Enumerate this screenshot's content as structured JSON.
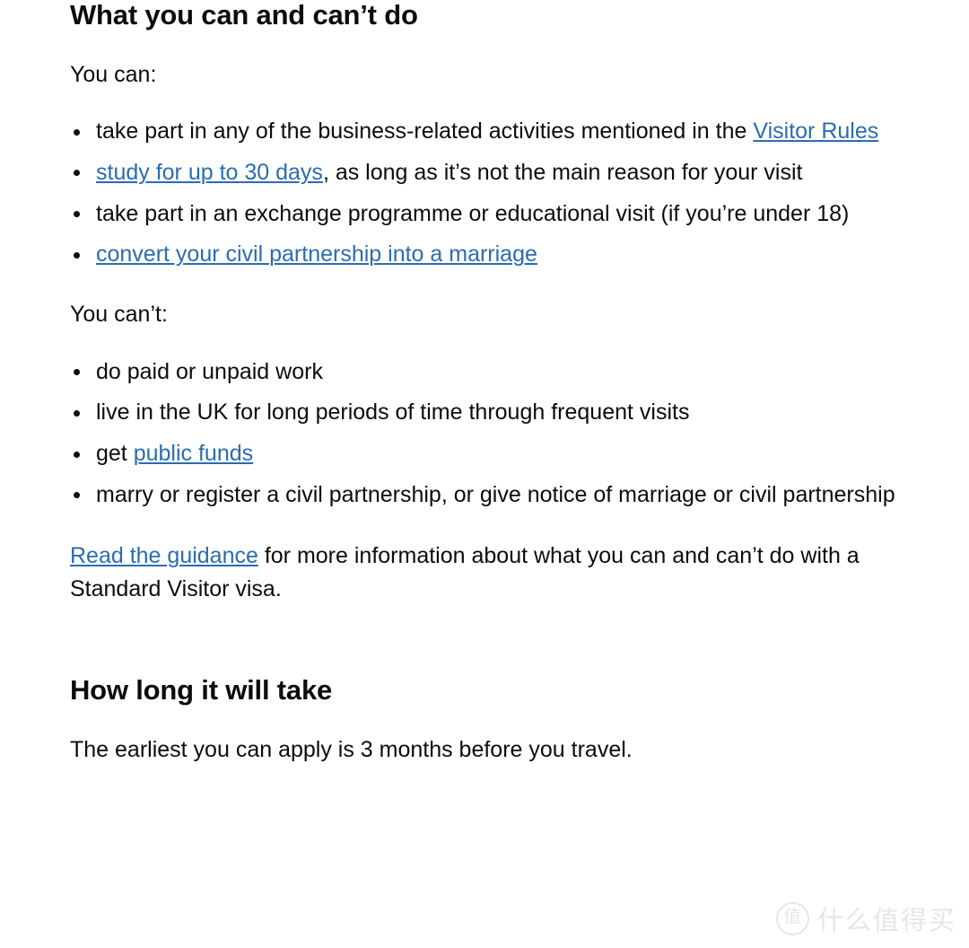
{
  "section_one": {
    "heading": "What you can and can’t do",
    "can_intro": "You can:",
    "can_items": [
      {
        "before": "take part in any of the business-related activities mentioned in the ",
        "link": "Visitor Rules",
        "after": ""
      },
      {
        "before": "",
        "link": "study for up to 30 days",
        "after": ", as long as it’s not the main reason for your visit"
      },
      {
        "before": "take part in an exchange programme or educational visit (if you’re under 18)",
        "link": "",
        "after": ""
      },
      {
        "before": "",
        "link": "convert your civil partnership into a marriage",
        "after": ""
      }
    ],
    "cannot_intro": "You can’t:",
    "cannot_items": [
      {
        "before": "do paid or unpaid work",
        "link": "",
        "after": ""
      },
      {
        "before": "live in the UK for long periods of time through frequent visits",
        "link": "",
        "after": ""
      },
      {
        "before": "get ",
        "link": "public funds",
        "after": ""
      },
      {
        "before": "marry or register a civil partnership, or give notice of marriage or civil partnership",
        "link": "",
        "after": ""
      }
    ],
    "read_guidance": {
      "link": "Read the guidance",
      "after": " for more information about what you can and can’t do with a Standard Visitor visa."
    }
  },
  "section_two": {
    "heading": "How long it will take",
    "paragraph": "The earliest you can apply is 3 months before you travel."
  },
  "watermark": {
    "badge": "值",
    "text": "什么值得买"
  },
  "colors": {
    "text": "#0b0c0c",
    "link": "#2b6cb0",
    "background": "#ffffff",
    "watermark": "#e6e6e6"
  }
}
